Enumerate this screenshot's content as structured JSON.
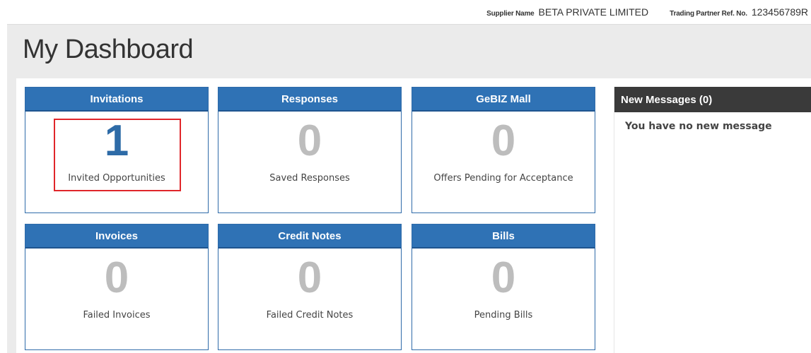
{
  "header": {
    "supplier_label": "Supplier Name",
    "supplier_value": "BETA PRIVATE LIMITED",
    "partner_label": "Trading Partner Ref. No.",
    "partner_value": "123456789R"
  },
  "page_title": "My Dashboard",
  "tiles": [
    {
      "title": "Invitations",
      "count": "1",
      "desc": "Invited Opportunities"
    },
    {
      "title": "Responses",
      "count": "0",
      "desc": "Saved Responses"
    },
    {
      "title": "GeBIZ Mall",
      "count": "0",
      "desc": "Offers Pending for Acceptance"
    },
    {
      "title": "Invoices",
      "count": "0",
      "desc": "Failed Invoices"
    },
    {
      "title": "Credit Notes",
      "count": "0",
      "desc": "Failed Credit Notes"
    },
    {
      "title": "Bills",
      "count": "0",
      "desc": "Pending Bills"
    }
  ],
  "messages": {
    "title": "New Messages (0)",
    "empty_text": "You have no new message"
  },
  "colors": {
    "tile_header": "#2f72b5",
    "active_count": "#2e6ba7",
    "inactive_count": "#bdbdbd",
    "highlight": "#e0262a",
    "messages_header": "#3a3a3a"
  }
}
